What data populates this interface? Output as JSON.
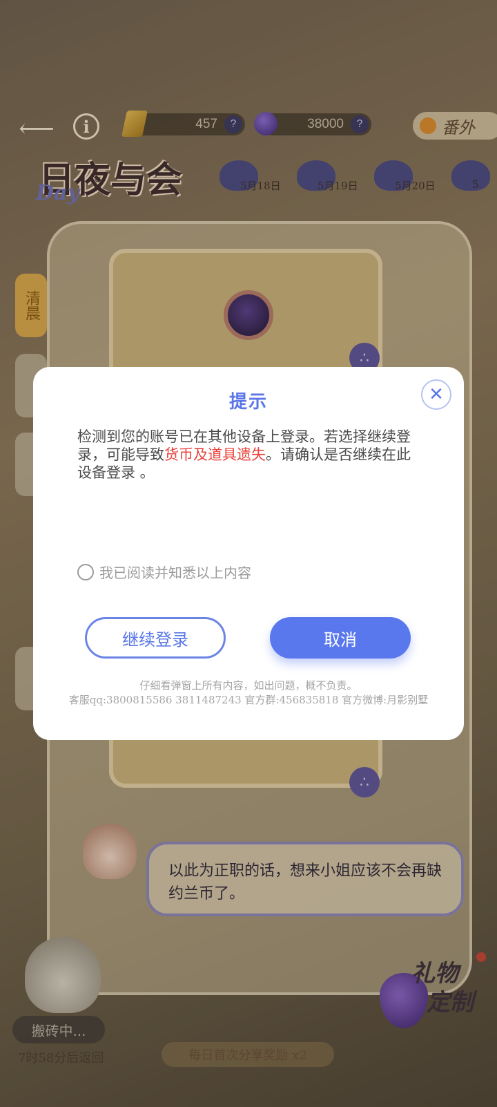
{
  "topbar": {
    "gold_amount": "457",
    "gem_amount": "38000",
    "help_glyph": "?",
    "extra_label": "番外"
  },
  "title": {
    "logo_text": "日夜与会",
    "logo_sub": "Day"
  },
  "dates": [
    "5月18日",
    "5月19日",
    "5月20日",
    "5"
  ],
  "side_tabs": {
    "first": "清晨",
    "second": "",
    "third": "",
    "fourth": ""
  },
  "dialogue": {
    "text": "以此为正职的话，想来小姐应该不会再缺约兰币了。"
  },
  "status": {
    "busy_label": "搬砖中...",
    "return_text": "7时58分后返回",
    "share_reward": "每日首次分享奖励 x2",
    "gift_label_1": "礼物",
    "gift_label_2": "定制"
  },
  "modal": {
    "title": "提示",
    "close_glyph": "✕",
    "message_part1": "检测到您的账号已在其他设备上登录。若选择继续登录，可能导致",
    "message_warning": "货币及道具遗失",
    "message_part2": "。请确认是否继续在此设备登录 。",
    "agree_label": "我已阅读并知悉以上内容",
    "continue_label": "继续登录",
    "cancel_label": "取消",
    "footnote_line1": "仔细看弹窗上所有内容，如出问题，概不负责。",
    "footnote_line2": "客服qq:3800815586   3811487243 官方群:456835818 官方微博:月影别墅"
  },
  "colors": {
    "accent": "#5a78ee",
    "warning": "#e8443c"
  }
}
